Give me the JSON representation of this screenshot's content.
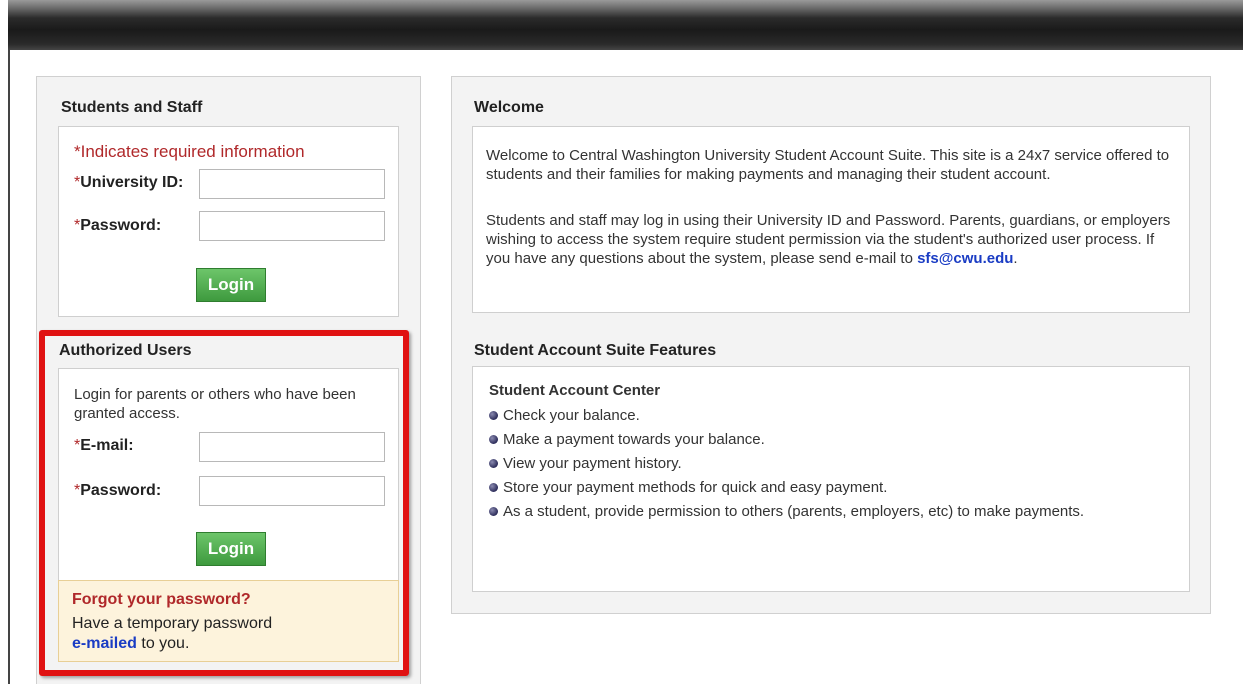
{
  "students_staff": {
    "title": "Students and Staff",
    "required_note": "*Indicates required information",
    "university_id_label": "University ID:",
    "password_label": "Password:",
    "university_id_value": "",
    "password_value": "",
    "login_label": "Login"
  },
  "authorized_users": {
    "title": "Authorized Users",
    "intro": "Login for parents or others who have been granted access.",
    "email_label": "E-mail:",
    "password_label": "Password:",
    "email_value": "",
    "password_value": "",
    "login_label": "Login",
    "forgot_title": "Forgot your password?",
    "forgot_text_1": "Have a temporary password",
    "forgot_link": "e-mailed",
    "forgot_text_2": " to you."
  },
  "welcome": {
    "title": "Welcome",
    "para1": "Welcome to Central Washington University Student Account Suite. This site is a 24x7 service offered to students and their families for making payments and managing their student account.",
    "para2_prefix": "Students and staff may log in using their University ID and Password. Parents, guardians, or employers wishing to access the system require student permission via the student's authorized user process. If you have any questions about the system, please send e-mail to ",
    "email_link": "sfs@cwu.edu",
    "para2_suffix": "."
  },
  "features": {
    "title": "Student Account Suite Features",
    "subtitle": "Student Account Center",
    "items": [
      "Check your balance.",
      "Make a payment towards your balance.",
      "View your payment history.",
      "Store your payment methods for quick and easy payment.",
      "As a student, provide permission to others (parents, employers, etc) to make payments."
    ]
  },
  "colors": {
    "required_red": "#b0282a",
    "button_green": "#4fae4d",
    "highlight_red": "#e01212",
    "link_blue": "#1a3cc4"
  }
}
